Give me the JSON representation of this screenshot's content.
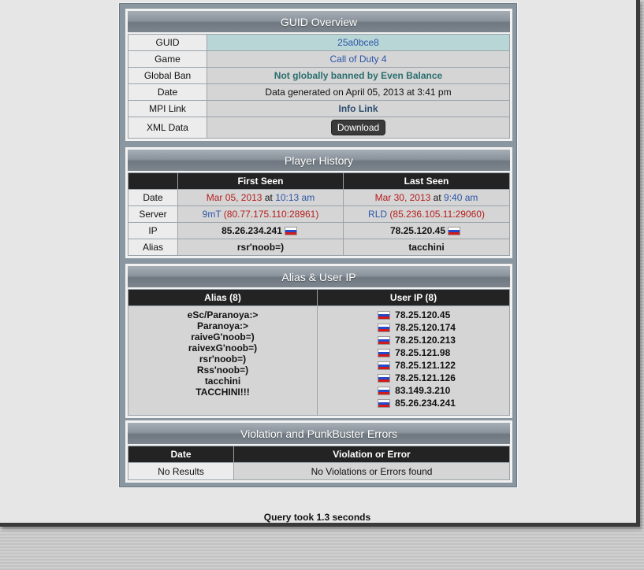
{
  "guid_overview": {
    "title": "GUID Overview",
    "rows": {
      "guid": {
        "label": "GUID",
        "value": "25a0bce8"
      },
      "game": {
        "label": "Game",
        "value": "Call of Duty 4"
      },
      "global_ban": {
        "label": "Global Ban",
        "value": "Not globally banned by Even Balance"
      },
      "date": {
        "label": "Date",
        "value": "Data generated on April 05, 2013 at 3:41 pm"
      },
      "mpi": {
        "label": "MPI Link",
        "value": "Info Link"
      },
      "xml": {
        "label": "XML Data",
        "button": "Download"
      }
    }
  },
  "player_history": {
    "title": "Player History",
    "col_first": "First Seen",
    "col_last": "Last Seen",
    "labels": {
      "date": "Date",
      "server": "Server",
      "ip": "IP",
      "alias": "Alias"
    },
    "first": {
      "date": "Mar 05, 2013",
      "at": "at",
      "time": "10:13 am",
      "server_name": "9mT",
      "server_addr": "(80.77.175.110:28961)",
      "ip": "85.26.234.241",
      "alias": "rsr'noob=)"
    },
    "last": {
      "date": "Mar 30, 2013",
      "at": "at",
      "time": "9:40 am",
      "server_name": "RLD",
      "server_addr": "(85.236.105.11:29060)",
      "ip": "78.25.120.45",
      "alias": "tacchini"
    }
  },
  "alias_ip": {
    "title": "Alias & User IP",
    "col_alias": "Alias (8)",
    "col_ip": "User IP (8)",
    "aliases": [
      "eSc/Paranoya:>",
      "Paranoya:>",
      "raiveG'noob=)",
      "raivexG'noob=)",
      "rsr'noob=)",
      "Rss'noob=)",
      "tacchini",
      "TACCHINI!!!"
    ],
    "ips": [
      "78.25.120.45",
      "78.25.120.174",
      "78.25.120.213",
      "78.25.121.98",
      "78.25.121.122",
      "78.25.121.126",
      "83.149.3.210",
      "85.26.234.241"
    ]
  },
  "violations": {
    "title": "Violation and PunkBuster Errors",
    "col_date": "Date",
    "col_violation": "Violation or Error",
    "date_value": "No Results",
    "violation_value": "No Violations or Errors found"
  },
  "footer": "Query took 1.3 seconds",
  "colors": {
    "link_blue": "#2c55a8",
    "date_red": "#b51d1d",
    "ban_teal": "#2a6e6e",
    "header_black": "#232323"
  },
  "flag_icon": "russia-flag-icon"
}
